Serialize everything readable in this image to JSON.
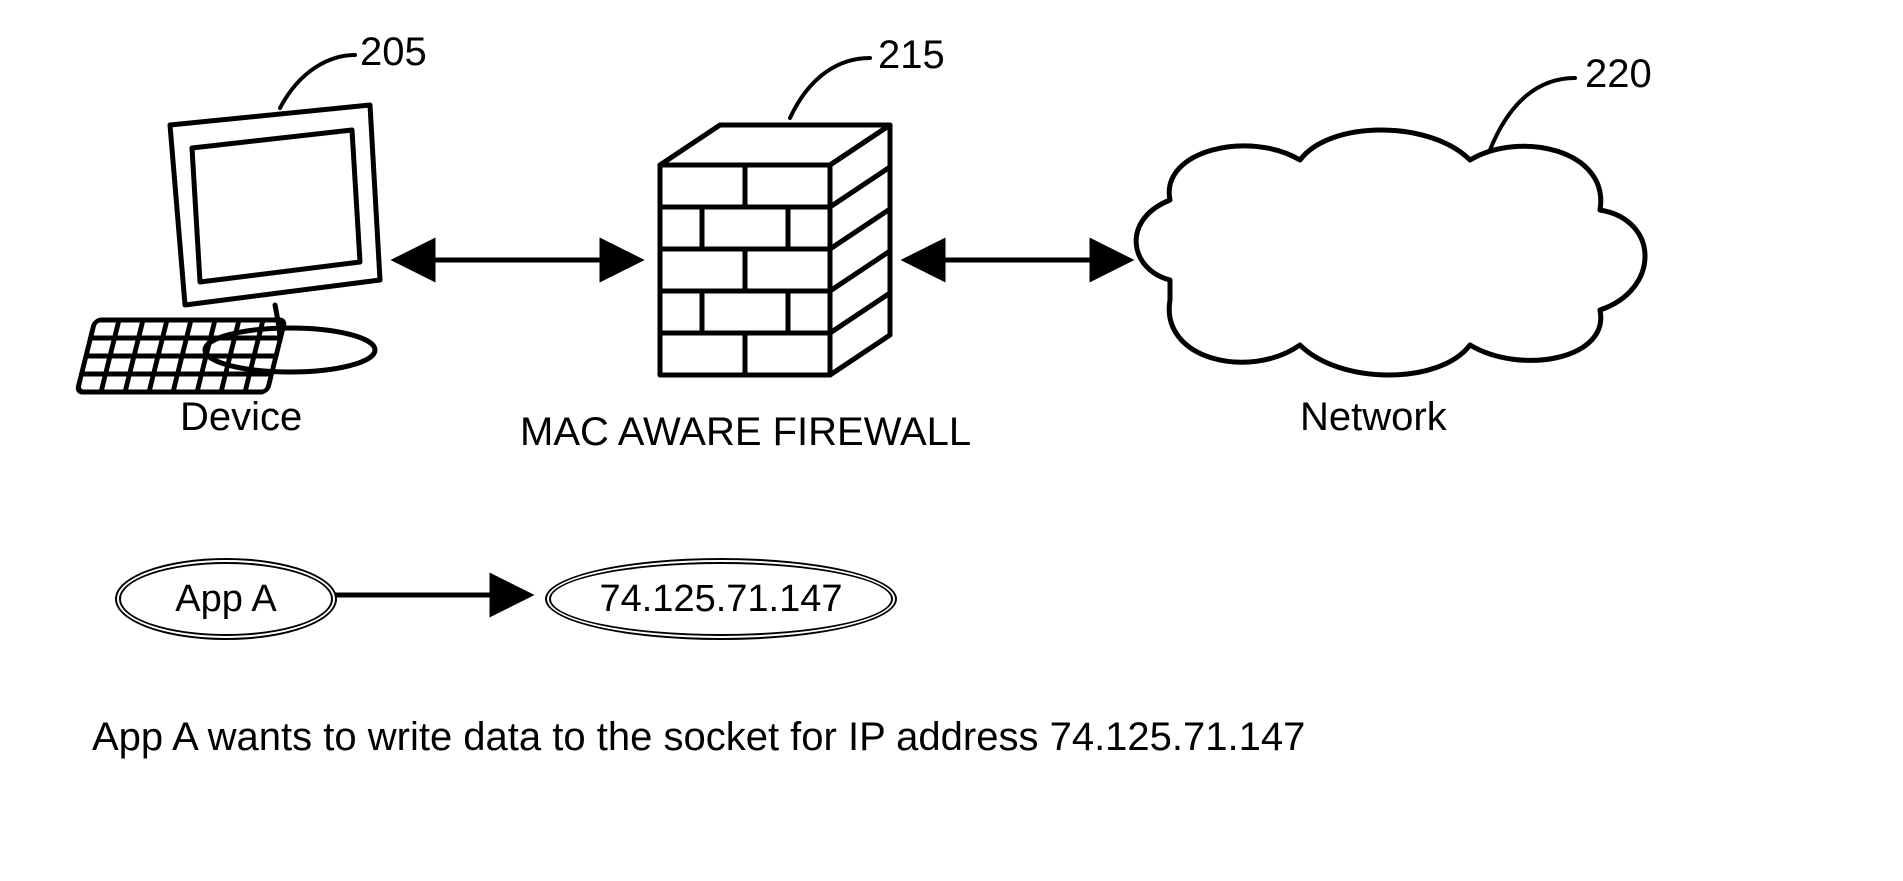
{
  "refs": {
    "device": "205",
    "firewall": "215",
    "network": "220"
  },
  "labels": {
    "device": "Device",
    "firewall": "MAC AWARE FIREWALL",
    "network": "Network"
  },
  "badges": {
    "app": "App  A",
    "ip": "74.125.71.147"
  },
  "caption": "App A wants to write data to the socket for IP address 74.125.71.147"
}
